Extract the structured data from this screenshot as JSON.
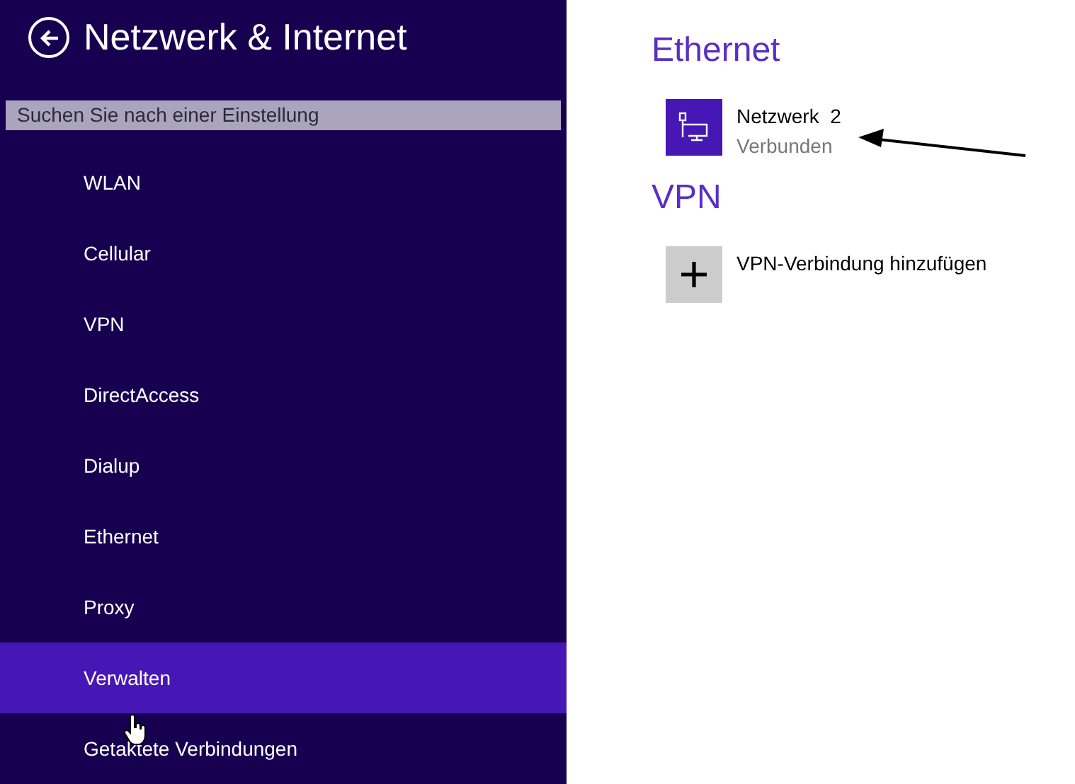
{
  "sidebar": {
    "title": "Netzwerk & Internet",
    "search": {
      "placeholder": "Suchen Sie nach einer Einstellung"
    },
    "items": [
      {
        "label": "WLAN",
        "selected": false
      },
      {
        "label": "Cellular",
        "selected": false
      },
      {
        "label": "VPN",
        "selected": false
      },
      {
        "label": "DirectAccess",
        "selected": false
      },
      {
        "label": "Dialup",
        "selected": false
      },
      {
        "label": "Ethernet",
        "selected": false
      },
      {
        "label": "Proxy",
        "selected": false
      },
      {
        "label": "Verwalten",
        "selected": true
      },
      {
        "label": "Getaktete Verbindungen",
        "selected": false
      }
    ]
  },
  "sections": [
    {
      "heading": "Ethernet",
      "entries": [
        {
          "kind": "network",
          "name": "Netzwerk  2",
          "status": "Verbunden"
        }
      ]
    },
    {
      "heading": "VPN",
      "entries": [
        {
          "kind": "add",
          "name": "VPN-Verbindung hinzufügen"
        }
      ]
    }
  ]
}
